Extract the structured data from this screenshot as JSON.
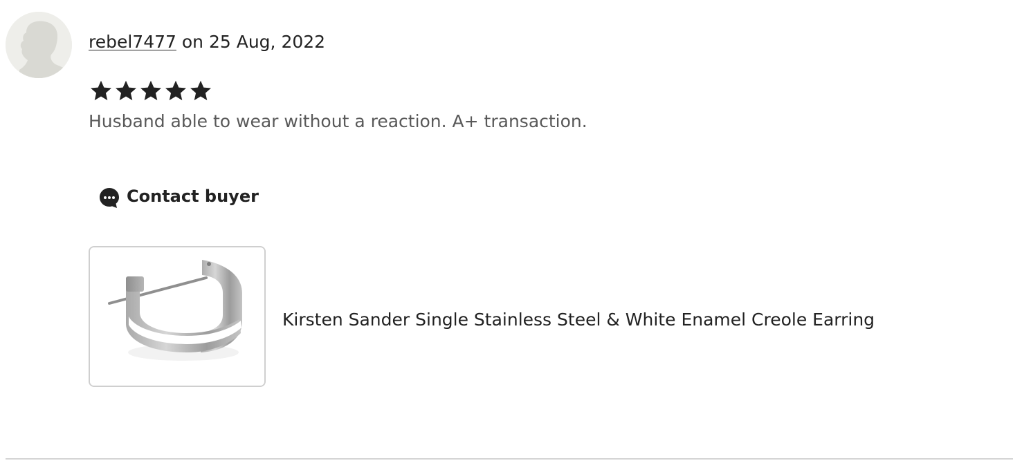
{
  "review": {
    "reviewer": "rebel7477",
    "date_text": " on 25 Aug, 2022",
    "rating": 5,
    "rating_max": 5,
    "text": "Husband able to wear without a reaction. A+ transaction.",
    "contact_label": "Contact buyer",
    "product_title": "Kirsten Sander Single Stainless Steel & White Enamel Creole Earring"
  },
  "icons": {
    "avatar": "default-avatar-silhouette",
    "star": "star-filled-icon",
    "contact": "chat-bubble-icon"
  },
  "colors": {
    "text": "#222222",
    "muted_text": "#595959",
    "avatar_bg": "#eeeeea",
    "border": "#cfcfcf"
  }
}
